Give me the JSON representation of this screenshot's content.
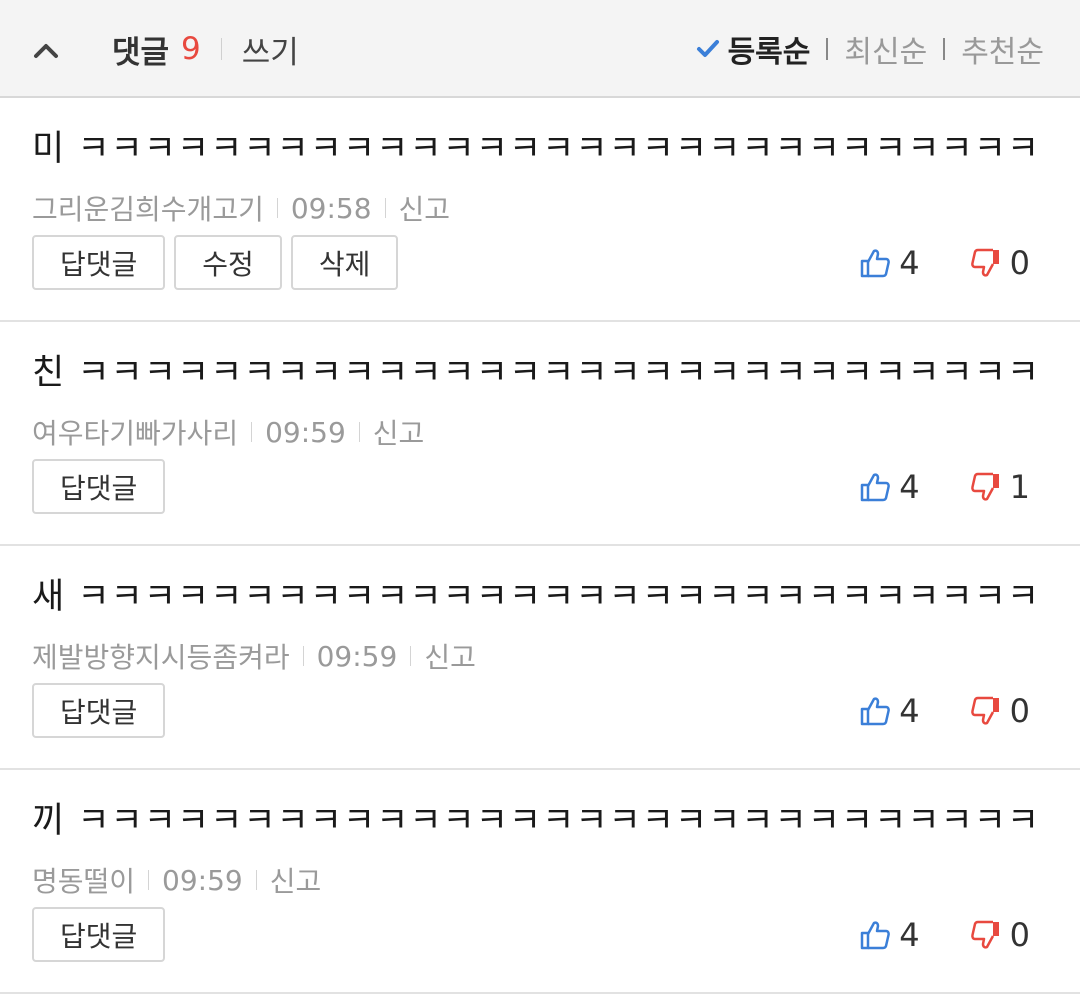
{
  "header": {
    "title": "댓글",
    "count": "9",
    "write_label": "쓰기",
    "sort_options": [
      "등록순",
      "최신순",
      "추천순"
    ]
  },
  "comments": [
    {
      "text": "미 ㅋㅋㅋㅋㅋㅋㅋㅋㅋㅋㅋㅋㅋㅋㅋㅋㅋㅋㅋㅋㅋㅋㅋㅋㅋㅋㅋㅋㅋ",
      "author": "그리운김희수개고기",
      "time": "09:58",
      "report": "신고",
      "buttons": [
        "답댓글",
        "수정",
        "삭제"
      ],
      "likes": "4",
      "dislikes": "0"
    },
    {
      "text": "친 ㅋㅋㅋㅋㅋㅋㅋㅋㅋㅋㅋㅋㅋㅋㅋㅋㅋㅋㅋㅋㅋㅋㅋㅋㅋㅋㅋㅋㅋ",
      "author": "여우타기빠가사리",
      "time": "09:59",
      "report": "신고",
      "buttons": [
        "답댓글"
      ],
      "likes": "4",
      "dislikes": "1"
    },
    {
      "text": "새 ㅋㅋㅋㅋㅋㅋㅋㅋㅋㅋㅋㅋㅋㅋㅋㅋㅋㅋㅋㅋㅋㅋㅋㅋㅋㅋㅋㅋㅋ",
      "author": "제발방향지시등좀켜라",
      "time": "09:59",
      "report": "신고",
      "buttons": [
        "답댓글"
      ],
      "likes": "4",
      "dislikes": "0"
    },
    {
      "text": "끼 ㅋㅋㅋㅋㅋㅋㅋㅋㅋㅋㅋㅋㅋㅋㅋㅋㅋㅋㅋㅋㅋㅋㅋㅋㅋㅋㅋㅋㅋ",
      "author": "명동떨이",
      "time": "09:59",
      "report": "신고",
      "buttons": [
        "답댓글"
      ],
      "likes": "4",
      "dislikes": "0"
    }
  ],
  "icons": {
    "collapse": "chevron-up-icon",
    "check": "check-icon",
    "like": "thumbs-up-icon",
    "dislike": "thumbs-down-icon"
  },
  "colors": {
    "count": "#e8493f",
    "check": "#3b7fd8",
    "like": "#3b7fd8",
    "dislike": "#e8493f"
  }
}
